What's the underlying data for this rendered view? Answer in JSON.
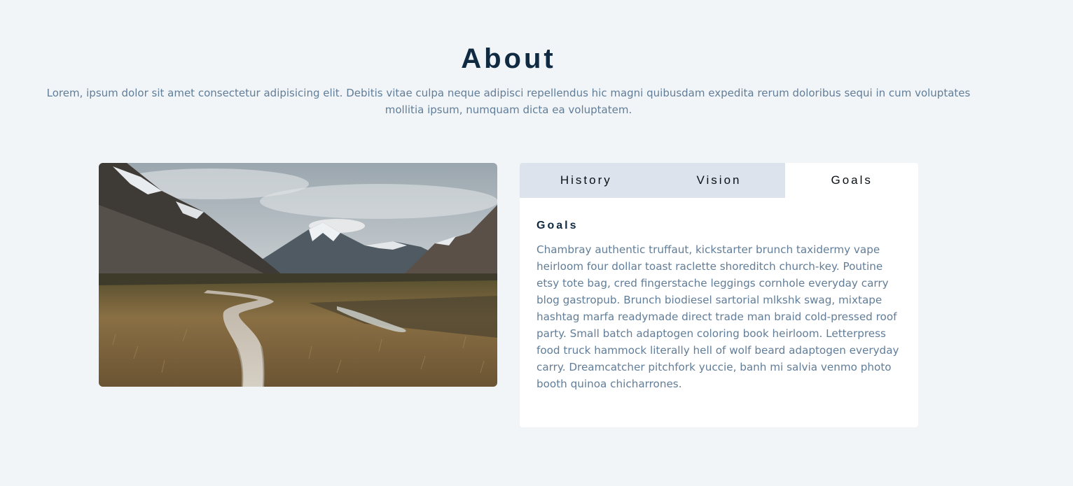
{
  "section": {
    "title": "About",
    "intro": "Lorem, ipsum dolor sit amet consectetur adipisicing elit. Debitis vitae culpa neque adipisci repellendus hic magni quibusdam expedita rerum doloribus sequi in cum voluptates mollitia ipsum, numquam dicta ea voluptatem."
  },
  "tabs": [
    {
      "label": "History",
      "active": false
    },
    {
      "label": "Vision",
      "active": false
    },
    {
      "label": "Goals",
      "active": true
    }
  ],
  "content": {
    "heading": "Goals",
    "body": "Chambray authentic truffaut, kickstarter brunch taxidermy vape heirloom four dollar toast raclette shoreditch church-key. Poutine etsy tote bag, cred fingerstache leggings cornhole everyday carry blog gastropub. Brunch biodiesel sartorial mlkshk swag, mixtape hashtag marfa readymade direct trade man braid cold-pressed roof party. Small batch adaptogen coloring book heirloom. Letterpress food truck hammock literally hell of wolf beard adaptogen everyday carry. Dreamcatcher pitchfork yuccie, banh mi salvia venmo photo booth quinoa chicharrones."
  },
  "colors": {
    "background": "#f1f5f8",
    "heading": "#102a42",
    "text": "#617d98",
    "tab_inactive": "#dde3ec",
    "tab_active": "#ffffff"
  }
}
